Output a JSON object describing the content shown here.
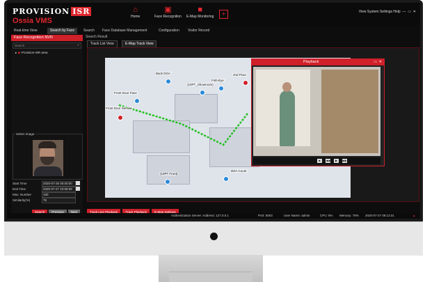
{
  "app": {
    "logo_text": "PROVISION",
    "logo_suffix": "ISR",
    "name": "Ossia VMS"
  },
  "nav": {
    "home": "Home",
    "face_recognition": "Face Recognition",
    "emap": "E-Map Monitoring",
    "plus": "+"
  },
  "system_menu": "View  System  Settings  Help",
  "tabs": [
    "Real-time View",
    "Search by Face",
    "Search",
    "Face Database Management",
    "Configuration",
    "Visitor Record"
  ],
  "sidebar": {
    "title": "Face Recognition NVR",
    "search_placeholder": "Search",
    "tree_item": "Provision-ISR area",
    "select_image_label": "Select Image",
    "fields": {
      "start_time_label": "Start Time",
      "start_time": "2020-07-26 00:00:00",
      "end_time_label": "End Time",
      "end_time": "2020-07-27 23:59:59",
      "max_number_label": "Max. Number",
      "max_number": "100",
      "similarity_label": "Similarity(%)",
      "similarity": "75"
    },
    "buttons": {
      "search": "Search",
      "previous": "Previous",
      "next": "Next"
    }
  },
  "main": {
    "search_result_label": "Search Result",
    "inner_tabs": [
      "Track List View",
      "E-Map Track View"
    ],
    "map_labels": [
      "Back DOA",
      "(10PT_Showroom)",
      "Fish-Eye",
      "2nd Floor",
      "Front Door Face",
      "Front Door Service",
      "DDA Count",
      "(10PT Front)"
    ],
    "playback": {
      "title": "Playback"
    },
    "bottom_buttons": [
      "Track Line Playback",
      "Track Playback",
      "E-Map Settings"
    ]
  },
  "status": {
    "server": "Authentication Server:  Address: 127.0.0.1",
    "port": "Port: 6003",
    "user": "User Name: admin",
    "cpu": "CPU: 8%",
    "memory": "Memory: 78%",
    "datetime": "2020-07-27 09:13:31"
  },
  "colors": {
    "accent": "#d0202a",
    "background": "#0d0d0d"
  }
}
